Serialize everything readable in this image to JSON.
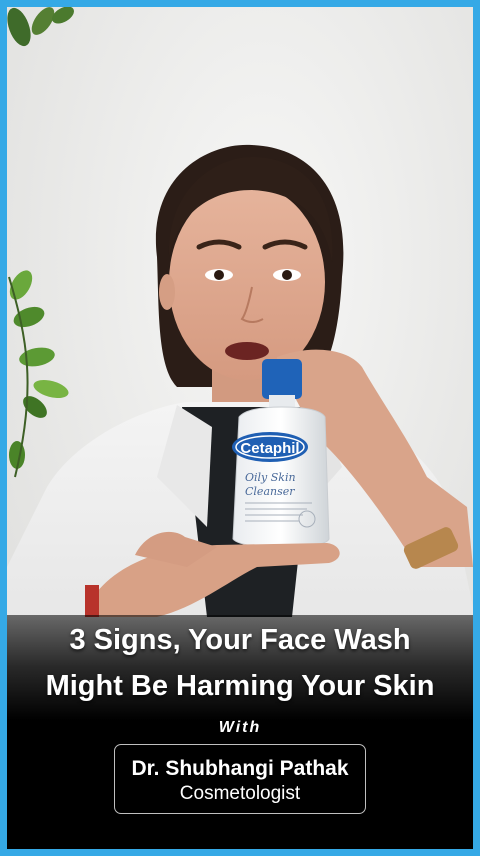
{
  "headline": {
    "line1": "3 Signs, Your Face Wash",
    "line2": "Might Be Harming Your Skin"
  },
  "with_label": "With",
  "presenter": {
    "name": "Dr. Shubhangi Pathak",
    "title": "Cosmetologist"
  },
  "product": {
    "brand": "Cetaphil",
    "line1": "Oily Skin",
    "line2": "Cleanser"
  },
  "colors": {
    "frame_border": "#35a9e6",
    "cetaphil_blue": "#1f5fb3",
    "bottle_cap": "#1f63b8"
  }
}
